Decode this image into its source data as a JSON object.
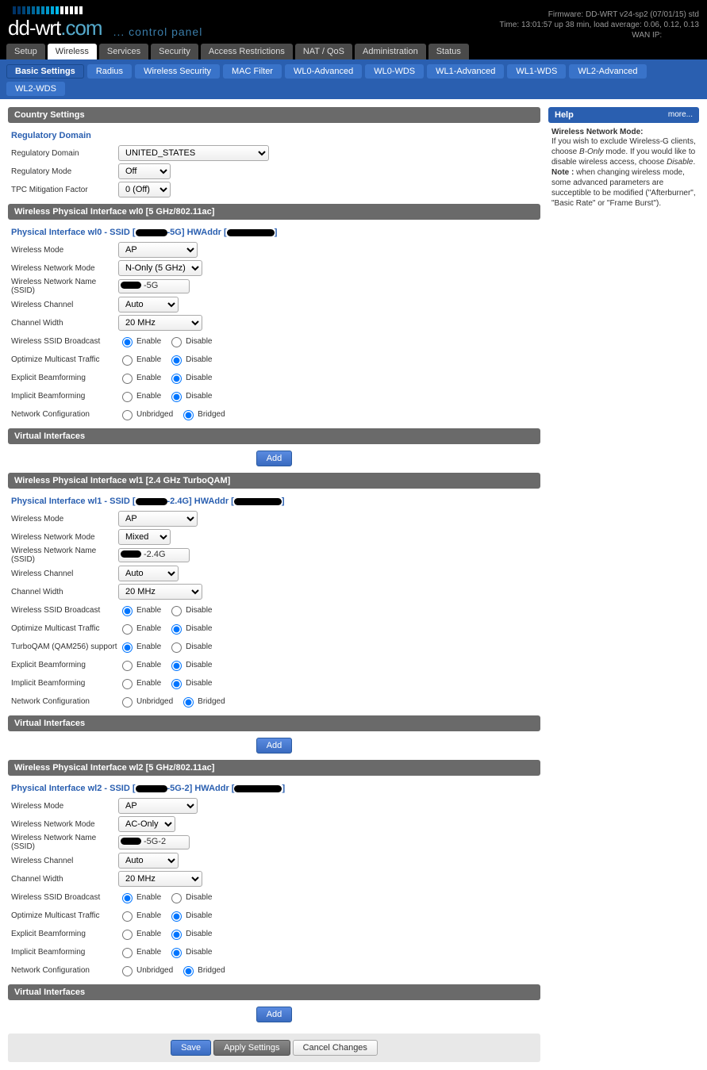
{
  "header": {
    "firmware": "Firmware: DD-WRT v24-sp2 (07/01/15) std",
    "time": "Time: 13:01:57 up 38 min, load average: 0.06, 0.12, 0.13",
    "wan": "WAN IP:",
    "cp": "... control panel"
  },
  "tabs1": [
    "Setup",
    "Wireless",
    "Services",
    "Security",
    "Access Restrictions",
    "NAT / QoS",
    "Administration",
    "Status"
  ],
  "tabs1_active": 1,
  "tabs2": [
    "Basic Settings",
    "Radius",
    "Wireless Security",
    "MAC Filter",
    "WL0-Advanced",
    "WL0-WDS",
    "WL1-Advanced",
    "WL1-WDS",
    "WL2-Advanced",
    "WL2-WDS"
  ],
  "tabs2_active": 0,
  "country": {
    "title": "Country Settings",
    "legend": "Regulatory Domain",
    "domain_lbl": "Regulatory Domain",
    "domain_val": "UNITED_STATES",
    "mode_lbl": "Regulatory Mode",
    "mode_val": "Off",
    "tpc_lbl": "TPC Mitigation Factor",
    "tpc_val": "0 (Off)"
  },
  "wl": [
    {
      "bar": "Wireless Physical Interface wl0 [5 GHz/802.11ac]",
      "legend_pre": "Physical Interface wl0 - SSID [",
      "legend_mid": "-5G] HWAddr [",
      "legend_post": "]",
      "mode": "AP",
      "netmode": "N-Only (5 GHz)",
      "ssid_suffix": "-5G",
      "chan": "Auto",
      "width": "20 MHz",
      "rows": [
        {
          "l": "Wireless SSID Broadcast",
          "a": "Enable",
          "b": "Disable",
          "sel": 0
        },
        {
          "l": "Optimize Multicast Traffic",
          "a": "Enable",
          "b": "Disable",
          "sel": 1
        },
        {
          "l": "Explicit Beamforming",
          "a": "Enable",
          "b": "Disable",
          "sel": 1
        },
        {
          "l": "Implicit Beamforming",
          "a": "Enable",
          "b": "Disable",
          "sel": 1
        },
        {
          "l": "Network Configuration",
          "a": "Unbridged",
          "b": "Bridged",
          "sel": 1
        }
      ]
    },
    {
      "bar": "Wireless Physical Interface wl1 [2.4 GHz TurboQAM]",
      "legend_pre": "Physical Interface wl1 - SSID [",
      "legend_mid": "-2.4G] HWAddr [",
      "legend_post": "]",
      "mode": "AP",
      "netmode": "Mixed",
      "ssid_suffix": "-2.4G",
      "chan": "Auto",
      "width": "20 MHz",
      "rows": [
        {
          "l": "Wireless SSID Broadcast",
          "a": "Enable",
          "b": "Disable",
          "sel": 0
        },
        {
          "l": "Optimize Multicast Traffic",
          "a": "Enable",
          "b": "Disable",
          "sel": 1
        },
        {
          "l": "TurboQAM (QAM256) support",
          "a": "Enable",
          "b": "Disable",
          "sel": 0
        },
        {
          "l": "Explicit Beamforming",
          "a": "Enable",
          "b": "Disable",
          "sel": 1
        },
        {
          "l": "Implicit Beamforming",
          "a": "Enable",
          "b": "Disable",
          "sel": 1
        },
        {
          "l": "Network Configuration",
          "a": "Unbridged",
          "b": "Bridged",
          "sel": 1
        }
      ]
    },
    {
      "bar": "Wireless Physical Interface wl2 [5 GHz/802.11ac]",
      "legend_pre": "Physical Interface wl2 - SSID [",
      "legend_mid": "-5G-2] HWAddr [",
      "legend_post": "]",
      "mode": "AP",
      "netmode": "AC-Only",
      "ssid_suffix": "-5G-2",
      "chan": "Auto",
      "width": "20 MHz",
      "rows": [
        {
          "l": "Wireless SSID Broadcast",
          "a": "Enable",
          "b": "Disable",
          "sel": 0
        },
        {
          "l": "Optimize Multicast Traffic",
          "a": "Enable",
          "b": "Disable",
          "sel": 1
        },
        {
          "l": "Explicit Beamforming",
          "a": "Enable",
          "b": "Disable",
          "sel": 1
        },
        {
          "l": "Implicit Beamforming",
          "a": "Enable",
          "b": "Disable",
          "sel": 1
        },
        {
          "l": "Network Configuration",
          "a": "Unbridged",
          "b": "Bridged",
          "sel": 1
        }
      ]
    }
  ],
  "labels": {
    "wmode": "Wireless Mode",
    "wnmode": "Wireless Network Mode",
    "ssid": "Wireless Network Name (SSID)",
    "chan": "Wireless Channel",
    "width": "Channel Width",
    "vi": "Virtual Interfaces",
    "add": "Add"
  },
  "footer": {
    "save": "Save",
    "apply": "Apply Settings",
    "cancel": "Cancel Changes"
  },
  "help": {
    "title": "Help",
    "more": "more...",
    "h": "Wireless Network Mode:",
    "body": "If you wish to exclude Wireless-G clients, choose <i>B-Only</i> mode. If you would like to disable wireless access, choose <i>Disable</i>.<br><b>Note :</b> when changing wireless mode, some advanced parameters are succeptible to be modified (\"Afterburner\", \"Basic Rate\" or \"Frame Burst\")."
  }
}
